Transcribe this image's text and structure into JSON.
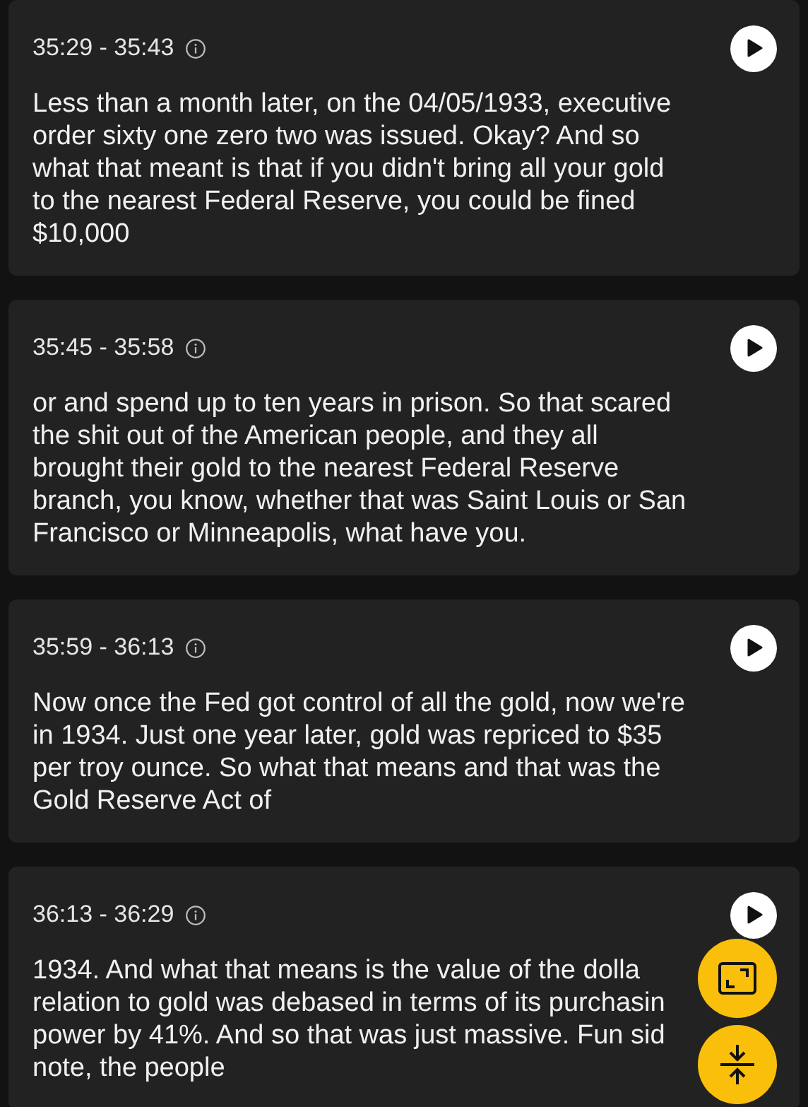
{
  "segments": [
    {
      "time": "35:29 - 35:43",
      "lines": [
        "Less than a month later, on the 04/05/1933, executive",
        "order sixty one zero two was issued. Okay? And so",
        "what that meant is that if you didn't bring all your gold",
        "to the nearest Federal Reserve, you could be fined",
        "$10,000"
      ]
    },
    {
      "time": "35:45 - 35:58",
      "lines": [
        "or and spend up to ten years in prison. So that scared",
        "the shit out of the American people, and they all",
        "brought their gold to the nearest Federal Reserve",
        "branch, you know, whether that was Saint Louis or San",
        "Francisco or Minneapolis, what have you."
      ]
    },
    {
      "time": "35:59 - 36:13",
      "lines": [
        "Now once the Fed got control of all the gold, now we're",
        "in 1934. Just one year later, gold was repriced to $35",
        "per troy ounce. So what that means and that was the",
        "Gold Reserve Act of"
      ]
    },
    {
      "time": "36:13 - 36:29",
      "lines": [
        "1934. And what that means is the value of the dolla",
        "relation to gold was debased in terms of its purchasin",
        "power by 41%. And so that was just massive. Fun sid",
        "note, the people"
      ]
    }
  ]
}
